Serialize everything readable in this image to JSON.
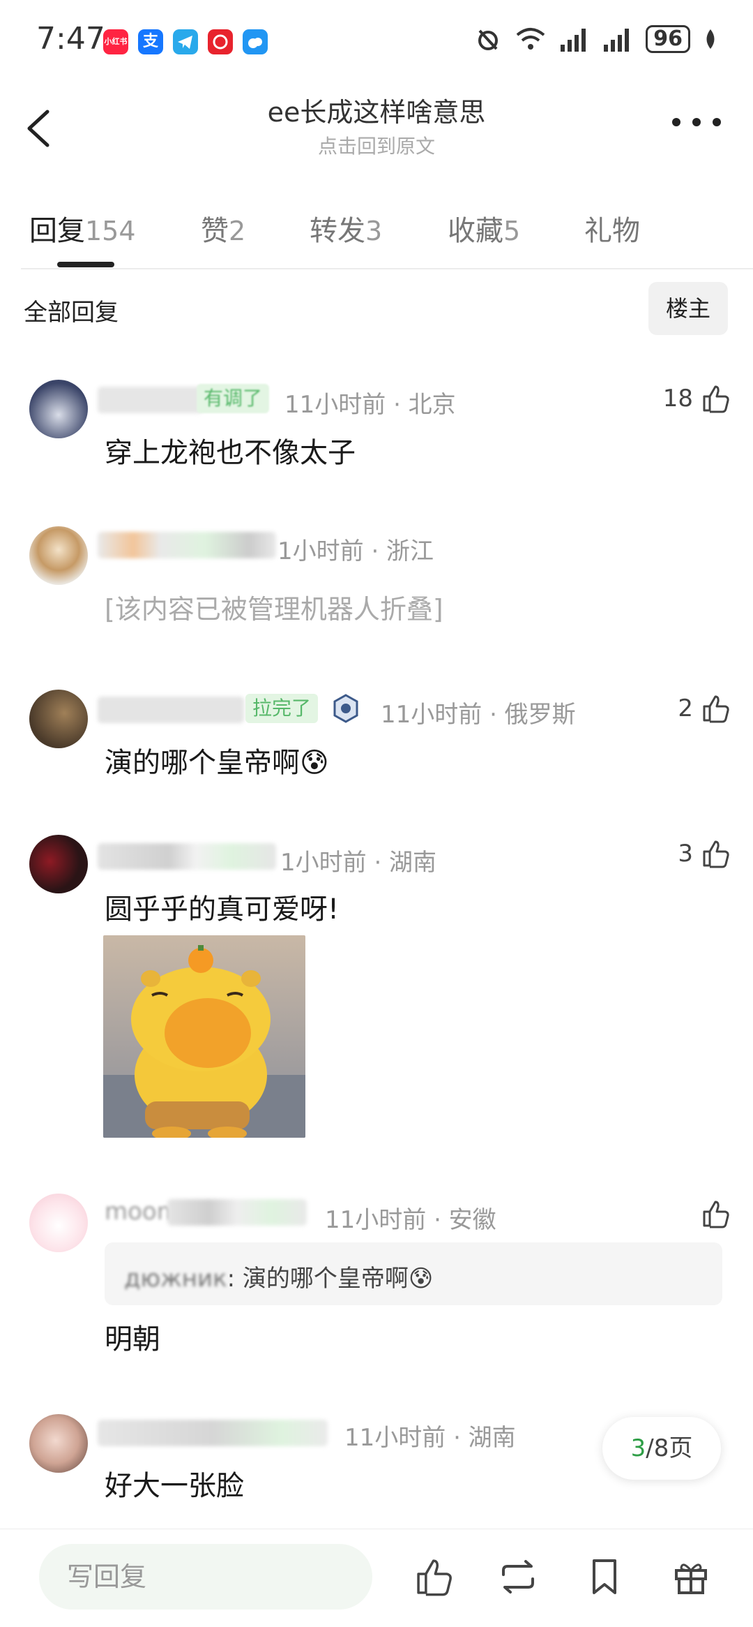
{
  "status_bar": {
    "time": "7:47",
    "battery": "96",
    "app_icons": [
      {
        "name": "xiaohongshu-icon",
        "label": "小红书",
        "color": "#ff2442"
      },
      {
        "name": "alipay-icon",
        "label": "支",
        "color": "#1677ff"
      },
      {
        "name": "telegram-icon",
        "label": "",
        "color": "#29a9eb"
      },
      {
        "name": "app-red-icon",
        "label": "",
        "color": "#e8232d"
      },
      {
        "name": "weather-icon",
        "label": "",
        "color": "#2196f3"
      }
    ]
  },
  "header": {
    "title": "ee长成这样啥意思",
    "subtitle": "点击回到原文"
  },
  "tabs": [
    {
      "label": "回复",
      "count": "154",
      "active": true
    },
    {
      "label": "赞",
      "count": "2"
    },
    {
      "label": "转发",
      "count": "3"
    },
    {
      "label": "收藏",
      "count": "5"
    },
    {
      "label": "礼物",
      "count": ""
    }
  ],
  "filter": {
    "label": "全部回复",
    "op_button": "楼主"
  },
  "comments": [
    {
      "badge": "有调了",
      "meta": "11小时前 · 北京",
      "text": "穿上龙袍也不像太子",
      "likes": "18"
    },
    {
      "meta": "1小时前 · 浙江",
      "text": "[该内容已被管理机器人折叠]",
      "likes": ""
    },
    {
      "badge": "拉完了",
      "meta": "11小时前 · 俄罗斯",
      "text": "演的哪个皇帝啊😰",
      "likes": "2"
    },
    {
      "meta": "1小时前 · 湖南",
      "text": "圆乎乎的真可爱呀!",
      "likes": "3"
    },
    {
      "name_partial": "moon",
      "meta": "11小时前 · 安徽",
      "quote_user": "дюжник",
      "quote_text": ": 演的哪个皇帝啊😰",
      "text": "明朝",
      "likes": ""
    },
    {
      "meta": "11小时前 · 湖南",
      "text": "好大一张脸",
      "likes": ""
    }
  ],
  "pager": {
    "current": "3",
    "rest": "/8页"
  },
  "bottom_bar": {
    "reply_placeholder": "写回复"
  },
  "colors": {
    "accent": "#2e9e46",
    "badge_bg": "#e3f5e3"
  }
}
